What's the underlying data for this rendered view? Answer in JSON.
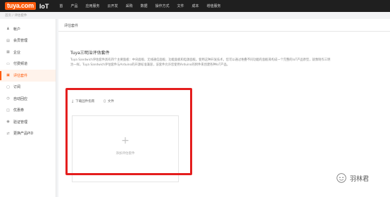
{
  "header": {
    "logo_mark": "tuya.com",
    "logo_text": "IoT",
    "nav": [
      "首",
      "产品",
      "应用服务",
      "云开发",
      "采购",
      "数据",
      "操作方式",
      "文件",
      "成本",
      "增值服务"
    ]
  },
  "breadcrumb": "首页 / 评估套件",
  "sidebar": {
    "items": [
      {
        "label": "帐户",
        "icon": "user-icon",
        "glyph": "♟"
      },
      {
        "label": "会员管理",
        "icon": "members-icon",
        "glyph": "▤"
      },
      {
        "label": "企业",
        "icon": "company-icon",
        "glyph": "▦"
      },
      {
        "label": "付费频道",
        "icon": "payment-icon",
        "glyph": "▭"
      },
      {
        "label": "评估套件",
        "icon": "kit-icon",
        "glyph": "▣"
      },
      {
        "label": "订阅",
        "icon": "subscribe-icon",
        "glyph": "▢"
      },
      {
        "label": "自动回应",
        "icon": "auto-reply-icon",
        "glyph": "◷"
      },
      {
        "label": "优惠券",
        "icon": "coupon-icon",
        "glyph": "◫"
      },
      {
        "label": "验证管理",
        "icon": "verify-icon",
        "glyph": "◉"
      },
      {
        "label": "更换产品PID",
        "icon": "swap-icon",
        "glyph": "⇄"
      }
    ],
    "active_index": 4
  },
  "main": {
    "title": "评估套件",
    "card": {
      "title": "Tuya三明治评估套件",
      "description": "Tuya Sandwich评估套件具有四个主要面板：中央面板、无线通信面板、功能面板和电源面板。使用这种开发技术，您可以通过堆叠不同功能的面板来构成一个完整的IoT产品原型，就像制作三明治一样。Tuya Sandwich评估套件与Arduino的开源标准兼容，该套件允许您使用Arduino的附件来创建各种IoT产品。",
      "links": [
        {
          "label": "下载固件指南",
          "icon": "download-icon",
          "glyph": "⤓"
        },
        {
          "label": "文件",
          "icon": "file-icon",
          "glyph": "▯"
        }
      ],
      "add_box": {
        "plus": "+",
        "label": "添加评估套件"
      }
    }
  },
  "watermark": {
    "text": "羽林君"
  },
  "colors": {
    "accent": "#ff5a0a",
    "highlight": "#e41e1e",
    "topbar": "#1f1f1f"
  }
}
